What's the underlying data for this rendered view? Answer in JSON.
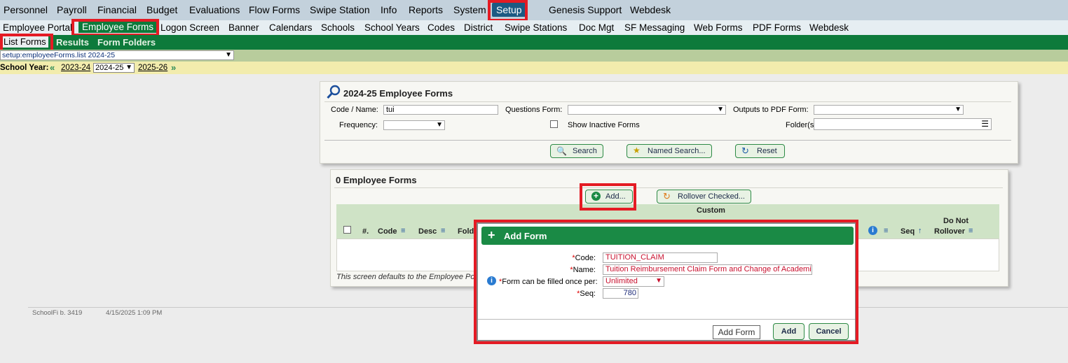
{
  "nav_main": [
    "Personnel",
    "Payroll",
    "Financial",
    "Budget",
    "Evaluations",
    "Flow Forms",
    "Swipe Station",
    "Info",
    "Reports",
    "System",
    "Setup",
    "Genesis Support",
    "Webdesk"
  ],
  "nav_sub": [
    "Employee Portal",
    "Employee Forms",
    "Logon Screen",
    "Banner",
    "Calendars",
    "Schools",
    "School Years",
    "Codes",
    "District",
    "Swipe Stations",
    "Doc Mgt",
    "SF Messaging",
    "Web Forms",
    "PDF Forms",
    "Webdesk"
  ],
  "nav_third": [
    "List Forms",
    "Results",
    "Form Folders"
  ],
  "path_select": "setup:employeeForms.list 2024-25",
  "school_year": {
    "label": "School Year:",
    "prev": "2023-24",
    "current": "2024-25",
    "next": "2025-26",
    "prev_arrow": "«",
    "next_arrow": "»"
  },
  "search_panel": {
    "title": "2024-25 Employee Forms",
    "code_name_label": "Code / Name:",
    "code_name_value": "tui",
    "questions_label": "Questions Form:",
    "outputs_label": "Outputs to PDF Form:",
    "frequency_label": "Frequency:",
    "inactive_label": "Show Inactive Forms",
    "folders_label": "Folder(s):",
    "search_btn": "Search",
    "named_search_btn": "Named Search...",
    "reset_btn": "Reset"
  },
  "results_panel": {
    "title": "0 Employee Forms",
    "add_btn": "Add...",
    "rollover_btn": "Rollover Checked...",
    "columns": {
      "num": "#.",
      "code": "Code",
      "desc": "Desc",
      "folder": "Folde",
      "custom": "Custom",
      "seq": "Seq",
      "do_not": "Do Not",
      "rollover": "Rollover"
    },
    "footer_note": "This screen defaults to the Employee Por"
  },
  "status": {
    "build": "SchoolFi b. 3419",
    "timestamp": "4/15/2025 1:09 PM"
  },
  "dialog": {
    "title": "Add Form",
    "code_label": "Code:",
    "code_value": "TUITION_CLAIM",
    "name_label": "Name:",
    "name_value": "Tuition Reimbursement Claim Form and Change of Academic",
    "once_label": "Form can be filled once per:",
    "once_value": "Unlimited",
    "seq_label": "Seq:",
    "seq_value": "780",
    "tooltip": "Add Form",
    "add_btn": "Add",
    "cancel_btn": "Cancel",
    "required_mark": "*"
  },
  "colors": {
    "green": "#0d7a3b",
    "highlight": "#e41b24",
    "navy": "#1c5a83"
  }
}
